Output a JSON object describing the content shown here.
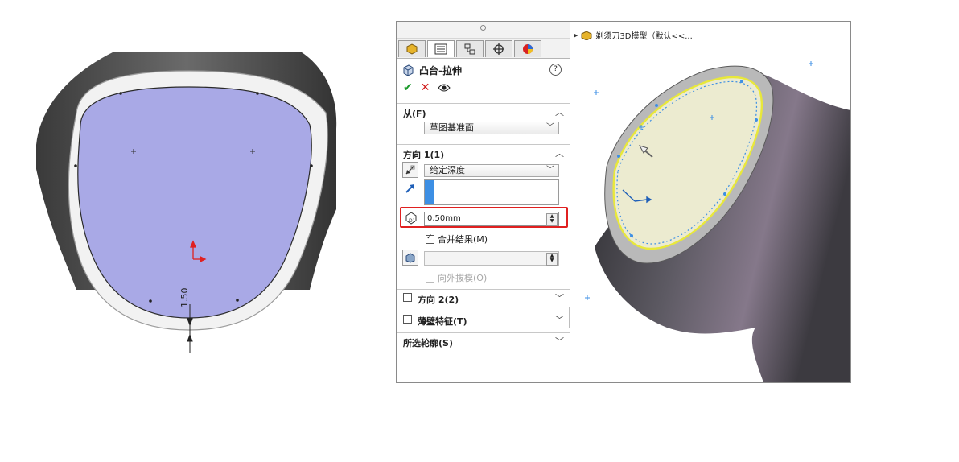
{
  "sketch": {
    "dimension_text": "1.50"
  },
  "property_manager": {
    "tabs": [
      "feature-manager",
      "property-manager",
      "configuration-manager",
      "dimxpert-manager",
      "display-manager"
    ],
    "feature_title": "凸台-拉伸",
    "from_section": {
      "label": "从(F)",
      "start_condition": "草图基准面"
    },
    "direction1_section": {
      "label": "方向 1(1)",
      "end_condition": "给定深度",
      "depth_value": "0.50mm",
      "merge_result_label": "合并结果(M)",
      "merge_result_checked": true,
      "draft_outward_label": "向外拔模(O)",
      "draft_outward_checked": false
    },
    "direction2_section": {
      "label": "方向 2(2)",
      "checked": false
    },
    "thin_feature_section": {
      "label": "薄壁特征(T)",
      "checked": false
    },
    "selected_contours_section": {
      "label": "所选轮廓(S)"
    }
  },
  "feature_tree": {
    "root_label": "剃须刀3D模型（默认<<..."
  },
  "colors": {
    "sketch_fill": "#a9a9e6",
    "highlight_box": "#e02020",
    "selection_edge": "#e8e83a",
    "face_fill": "#ecebd0"
  }
}
